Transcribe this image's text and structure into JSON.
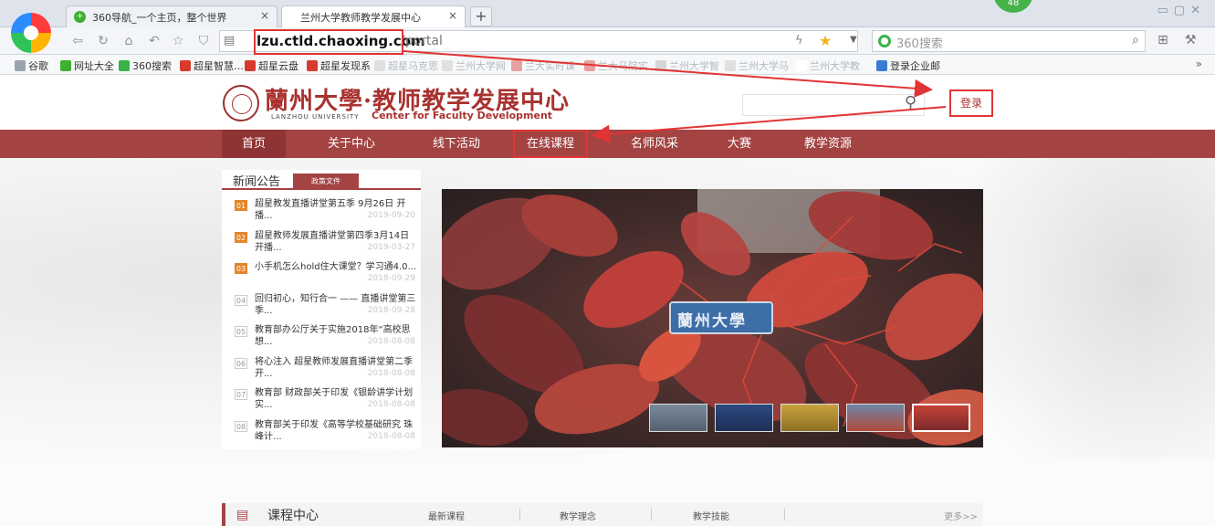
{
  "browser": {
    "tabs": [
      {
        "label": "360导航_一个主页，整个世界",
        "close": "×",
        "favicon": "+"
      },
      {
        "label": "兰州大学教师教学发展中心",
        "close": "×"
      }
    ],
    "new_tab": "+",
    "badge": "48",
    "address": {
      "host": "lzu.ctld.chaoxing.com",
      "path": "/portal"
    },
    "search_placeholder": "360搜索",
    "bookmarks": [
      {
        "label": "谷歌",
        "color": "#9aa3ad",
        "faded": false
      },
      {
        "label": "网址大全",
        "color": "#3db030",
        "faded": false
      },
      {
        "label": "360搜索",
        "color": "#38b348",
        "faded": false
      },
      {
        "label": "超星智慧…",
        "color": "#d93a2e",
        "faded": false
      },
      {
        "label": "超星云盘",
        "color": "#d93a2e",
        "faded": false
      },
      {
        "label": "超星发现系",
        "color": "#d93a2e",
        "faded": false
      },
      {
        "label": "超星马克思",
        "color": "#e0e0e0",
        "faded": true
      },
      {
        "label": "兰州大学网",
        "color": "#e0e0e0",
        "faded": true
      },
      {
        "label": "兰大实时课",
        "color": "#e8a0a0",
        "faded": true
      },
      {
        "label": "兰大马院实",
        "color": "#e8a0a0",
        "faded": true
      },
      {
        "label": "兰州大学智",
        "color": "#d5d5d5",
        "faded": true
      },
      {
        "label": "兰州大学马",
        "color": "#e0e0e0",
        "faded": true
      },
      {
        "label": "兰州大学教",
        "color": "#ffffff",
        "faded": true
      },
      {
        "label": "登录企业邮",
        "color": "#3a7bd5",
        "faded": false
      }
    ],
    "bookmarks_more": "»"
  },
  "site": {
    "title": "蘭州大學·教师教学发展中心",
    "university_en": "LANZHOU UNIVERSITY",
    "center_en": "Center for Faculty Development",
    "login": "登录",
    "nav": [
      {
        "label": "首页"
      },
      {
        "label": "关于中心"
      },
      {
        "label": "线下活动"
      },
      {
        "label": "在线课程"
      },
      {
        "label": "名师风采"
      },
      {
        "label": "大赛"
      },
      {
        "label": "教学资源"
      }
    ]
  },
  "news": {
    "tab_main": "新闻公告",
    "tab_policy": "政策文件",
    "items": [
      {
        "num": "01",
        "title": "超星教发直播讲堂第五季 9月26日 开播...",
        "date": "2019-09-20",
        "hot": true
      },
      {
        "num": "02",
        "title": "超星教师发展直播讲堂第四季3月14日开播...",
        "date": "2019-03-27",
        "hot": true
      },
      {
        "num": "03",
        "title": "小手机怎么hold住大课堂？学习通4.0...",
        "date": "2018-09-29",
        "hot": true
      },
      {
        "num": "04",
        "title": "回归初心，知行合一 —— 直播讲堂第三季...",
        "date": "2018-09-28",
        "hot": false
      },
      {
        "num": "05",
        "title": "教育部办公厅关于实施2018年“高校思想...",
        "date": "2018-08-08",
        "hot": false
      },
      {
        "num": "06",
        "title": "将心注入 超星教师发展直播讲堂第二季开...",
        "date": "2018-08-08",
        "hot": false
      },
      {
        "num": "07",
        "title": "教育部 财政部关于印发《银龄讲学计划 实...",
        "date": "2018-08-08",
        "hot": false
      },
      {
        "num": "08",
        "title": "教育部关于印发《高等学校基础研究 珠峰计...",
        "date": "2018-08-08",
        "hot": false
      }
    ]
  },
  "banner": {
    "sign_text": "蘭州大學",
    "thumbnails": 5,
    "active_thumbnail": 5
  },
  "course": {
    "title": "课程中心",
    "tabs": [
      "最新课程",
      "教学理念",
      "教学技能"
    ],
    "more": "更多>>"
  },
  "colors": {
    "brand": "#a34443",
    "annotation": "#e23434"
  }
}
